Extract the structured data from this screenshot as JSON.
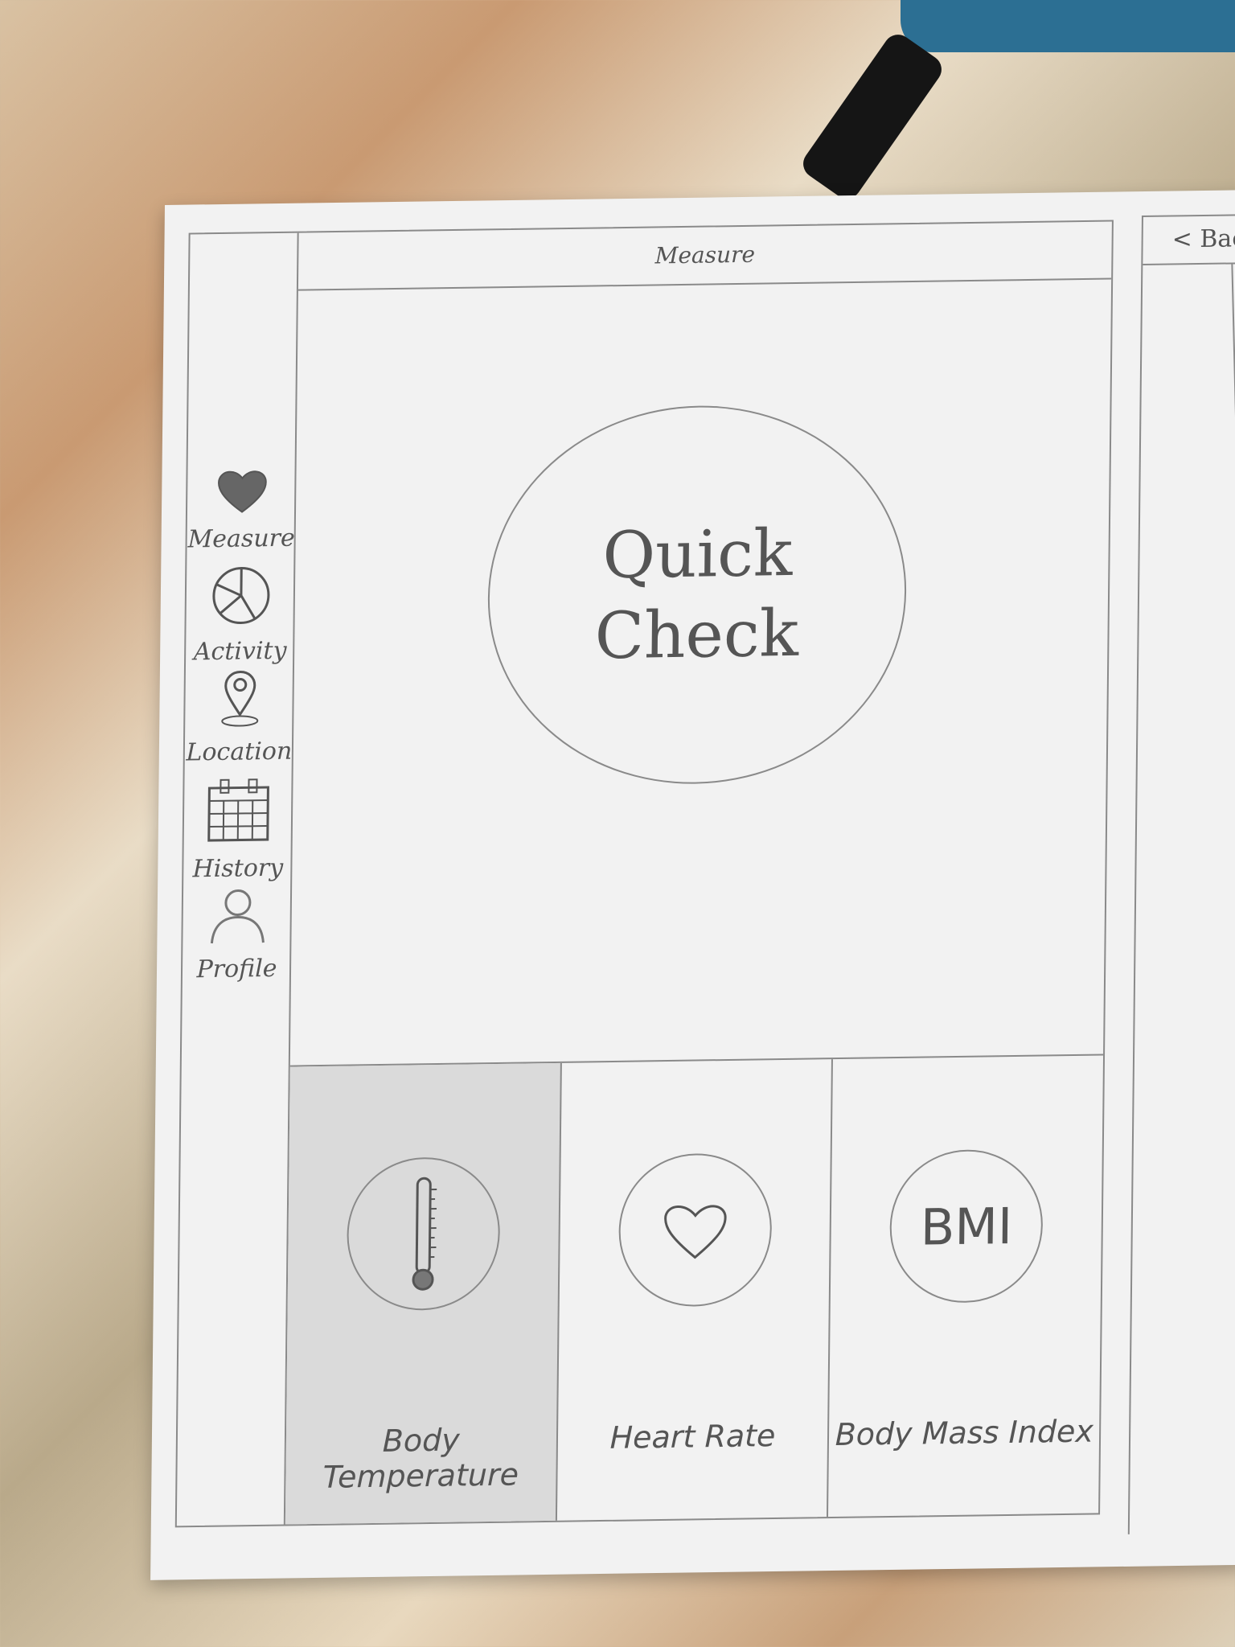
{
  "screen": {
    "header_title": "Measure",
    "sidebar": {
      "items": [
        {
          "label": "Measure",
          "icon": "heart-icon"
        },
        {
          "label": "Activity",
          "icon": "pie-chart-icon"
        },
        {
          "label": "Location",
          "icon": "map-pin-icon"
        },
        {
          "label": "History",
          "icon": "calendar-icon"
        },
        {
          "label": "Profile",
          "icon": "user-icon"
        }
      ]
    },
    "quick_check": {
      "line1": "Quick",
      "line2": "Check"
    },
    "tiles": [
      {
        "label": "Body Temperature",
        "icon": "thermometer-icon",
        "selected": true
      },
      {
        "label": "Heart Rate",
        "icon": "heart-outline-icon",
        "selected": false
      },
      {
        "label": "Body Mass Index",
        "icon_text": "BMI",
        "selected": false
      }
    ]
  },
  "next_screen": {
    "back_label": "< Back"
  }
}
